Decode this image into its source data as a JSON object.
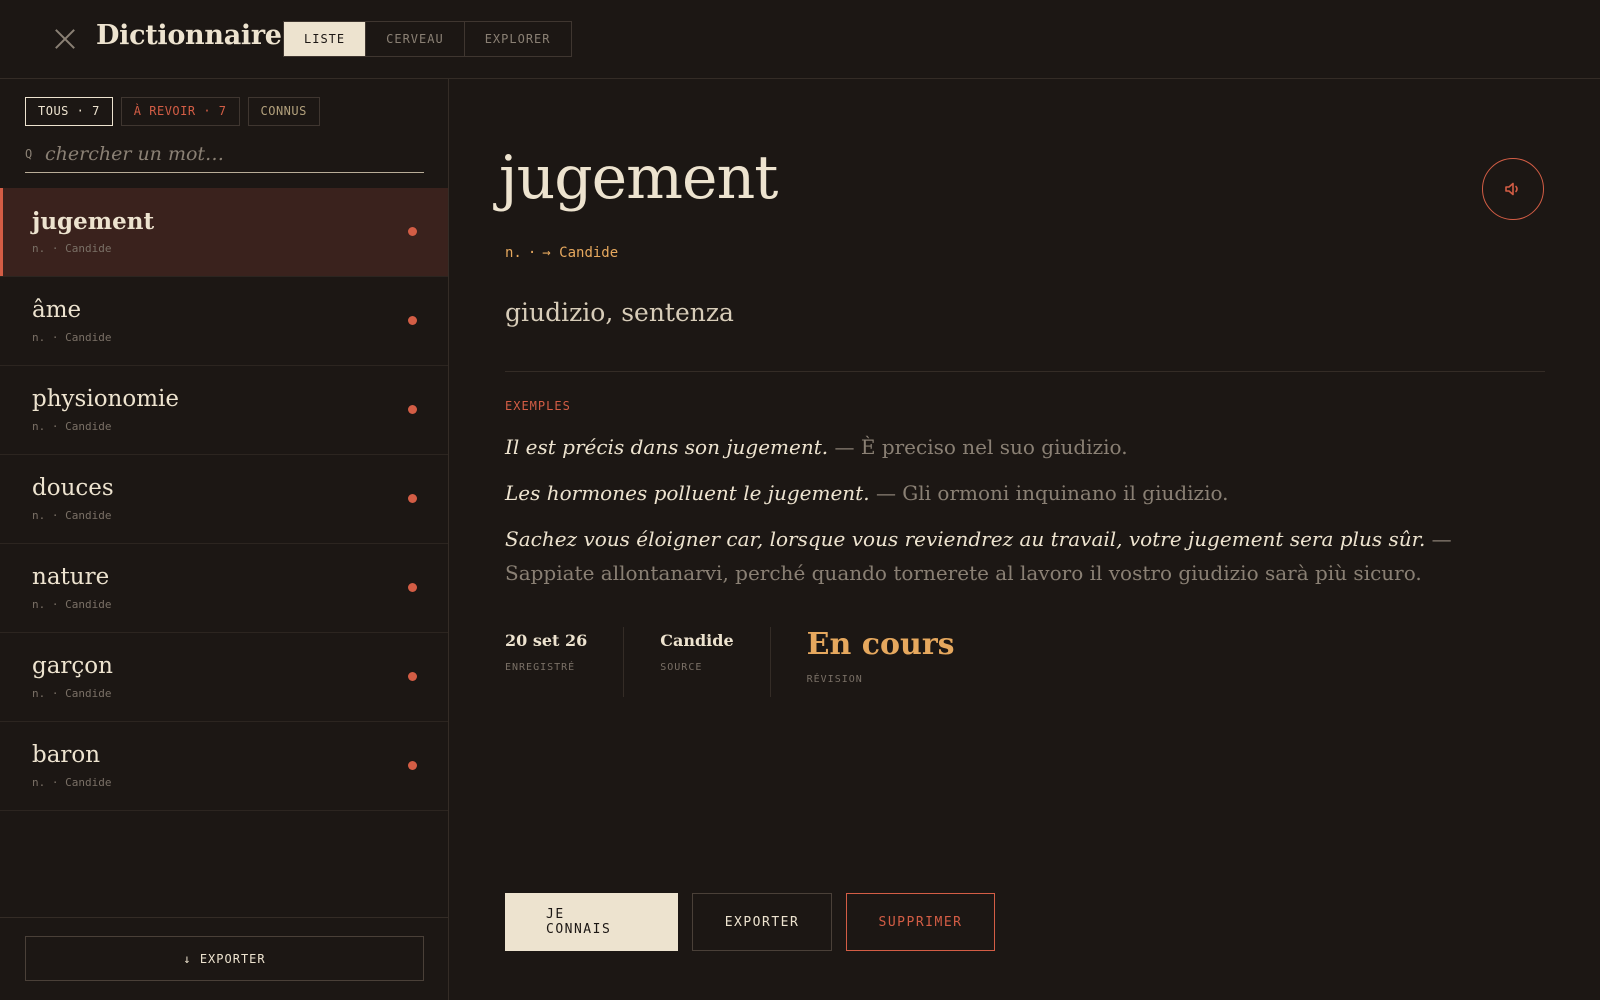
{
  "header": {
    "title": "Dictionnaire",
    "tabs": [
      "LISTE",
      "CERVEAU",
      "EXPLORER"
    ]
  },
  "sidebar": {
    "filters": {
      "all": "TOUS · 7",
      "review": "À REVOIR · 7",
      "known": "CONNUS"
    },
    "search_icon": "Q",
    "search_placeholder": "chercher un mot…",
    "words": [
      {
        "word": "jugement",
        "meta": "n. · Candide"
      },
      {
        "word": "âme",
        "meta": "n. · Candide"
      },
      {
        "word": "physionomie",
        "meta": "n. · Candide"
      },
      {
        "word": "douces",
        "meta": "n. · Candide"
      },
      {
        "word": "nature",
        "meta": "n. · Candide"
      },
      {
        "word": "garçon",
        "meta": "n. · Candide"
      },
      {
        "word": "baron",
        "meta": "n. · Candide"
      }
    ],
    "export_label": "↓ EXPORTER"
  },
  "detail": {
    "headword": "jugement",
    "pos": "n.",
    "source_link": "→ Candide",
    "translation": "giudizio, sentenza",
    "examples_label": "EXEMPLES",
    "examples": [
      {
        "fr": "Il est précis dans son jugement.",
        "it": " — È preciso nel suo giudizio."
      },
      {
        "fr": "Les hormones polluent le jugement.",
        "it": " — Gli ormoni inquinano il giudizio."
      },
      {
        "fr": "Sachez vous éloigner car, lorsque vous reviendrez au travail, votre jugement sera plus sûr.",
        "it": " — Sappiate allontanarvi, perché quando tornerete al lavoro il vostro giudizio sarà più sicuro."
      }
    ],
    "stats": {
      "date": "20 set 26",
      "date_label": "ENREGISTRÉ",
      "source": "Candide",
      "source_label": "SOURCE",
      "status": "En cours",
      "status_label": "RÉVISION"
    },
    "buttons": {
      "known": "JE CONNAIS",
      "export": "EXPORTER",
      "delete": "SUPPRIMER"
    }
  },
  "colors": {
    "background": "#1c1714",
    "text": "#ede3cf",
    "accent_red": "#d35d45",
    "accent_gold": "#e6a85e",
    "selected_bg": "#3a221d"
  },
  "icons": {
    "close": "close-icon",
    "audio": "speaker-icon",
    "search": "search-icon",
    "export": "download-arrow-icon",
    "unread_dot": "dot-icon"
  }
}
